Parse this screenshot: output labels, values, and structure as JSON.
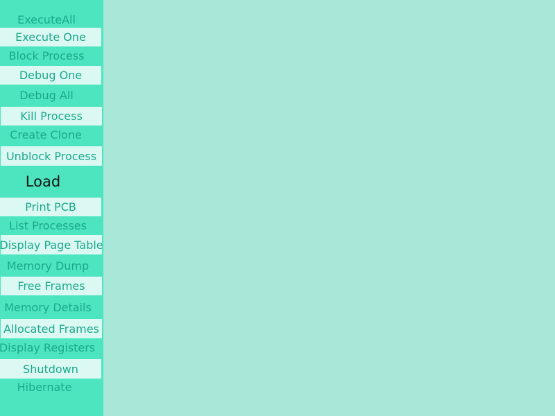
{
  "theme": {
    "sidebar_color": "#4de5c0",
    "content_color": "#a9e8d8",
    "button_color": "#dbf9f2",
    "text_color": "#1aa88a",
    "highlight_text_color": "#111111"
  },
  "menu": {
    "items": [
      {
        "label": "ExecuteAll"
      },
      {
        "label": "Execute One"
      },
      {
        "label": "Block Process"
      },
      {
        "label": "Debug One"
      },
      {
        "label": "Debug All"
      },
      {
        "label": "Kill Process"
      },
      {
        "label": "Create Clone"
      },
      {
        "label": "Unblock Process"
      },
      {
        "label": "Load"
      },
      {
        "label": "Print PCB"
      },
      {
        "label": "List Processes"
      },
      {
        "label": "Display Page Table"
      },
      {
        "label": "Memory Dump"
      },
      {
        "label": "Free Frames"
      },
      {
        "label": "Memory Details"
      },
      {
        "label": "Allocated Frames"
      },
      {
        "label": "Display Registers"
      },
      {
        "label": "Shutdown"
      },
      {
        "label": "Hibernate"
      }
    ]
  }
}
